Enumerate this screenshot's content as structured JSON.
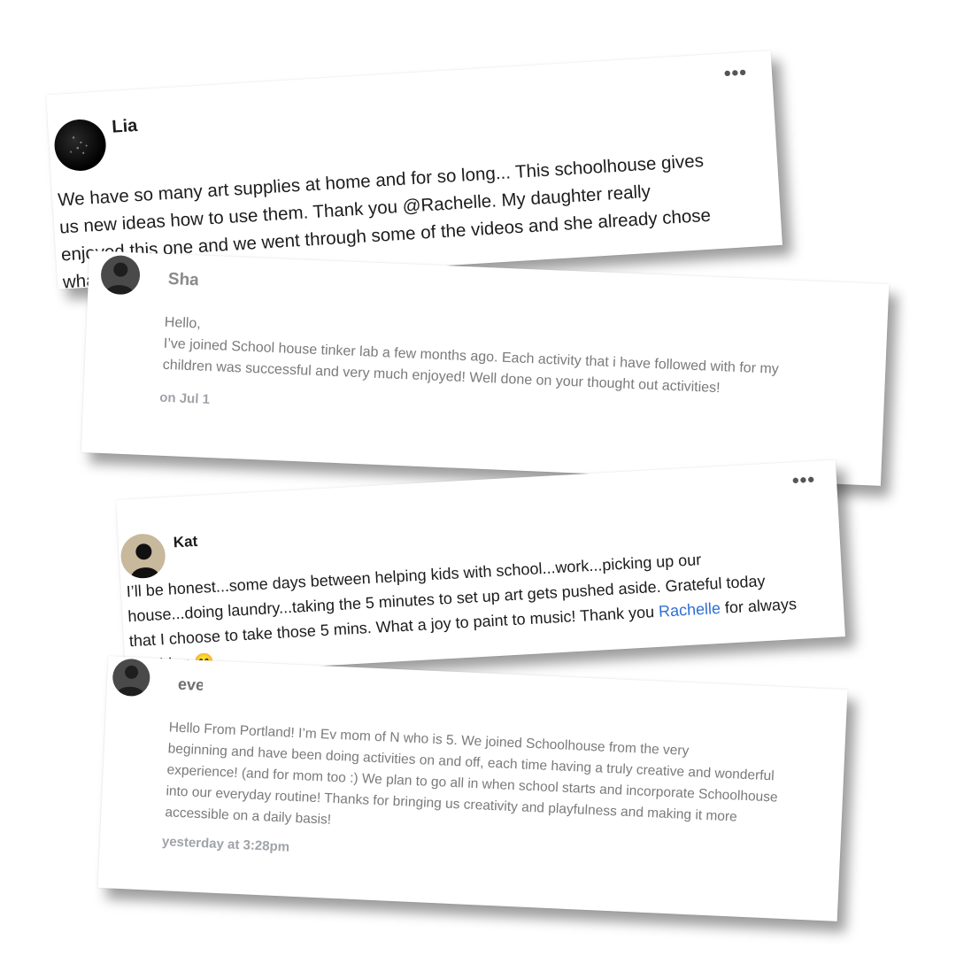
{
  "posts": [
    {
      "author": "Lia",
      "menu_icon": "•••",
      "text": "We have so many art supplies at home and for so long... This schoolhouse gives\nus new ideas how to use them. Thank you @Rachelle. My daughter really\nenjoyed this one and we went through some of the videos and she already chose\nwhat to tinker next..."
    },
    {
      "author": "Sha",
      "greeting": "Hello,",
      "text": "I’ve joined School house tinker lab a few months ago. Each activity that i have followed with for my\nchildren was successful and very much enjoyed! Well done on your thought out activities!",
      "date": "on Jul 1"
    },
    {
      "author": "Kat",
      "menu_icon": "•••",
      "text_before": "I’ll be honest...some days between helping kids with school...work...picking up our\nhouse...doing laundry...taking the 5 minutes to set up art gets pushed aside. Grateful today\nthat I choose to take those 5 mins. What a joy to paint to music! Thank you ",
      "mention": "Rachelle",
      "text_after": " for always\ninspiring 😊"
    },
    {
      "author": "eve",
      "text": "Hello From Portland! I’m Ev             mom of N         who is 5. We joined Schoolhouse from the very\nbeginning and have been doing activities on and off, each time having a truly creative and wonderful\nexperience! (and for mom too :) We plan to go all in when school starts and incorporate Schoolhouse\ninto our everyday routine! Thanks for bringing us creativity and playfulness and making it more\naccessible on a daily basis!",
      "date": "yesterday at 3:28pm"
    }
  ],
  "colors": {
    "mention": "#2f6fd6",
    "meta": "#a0a3a8"
  }
}
